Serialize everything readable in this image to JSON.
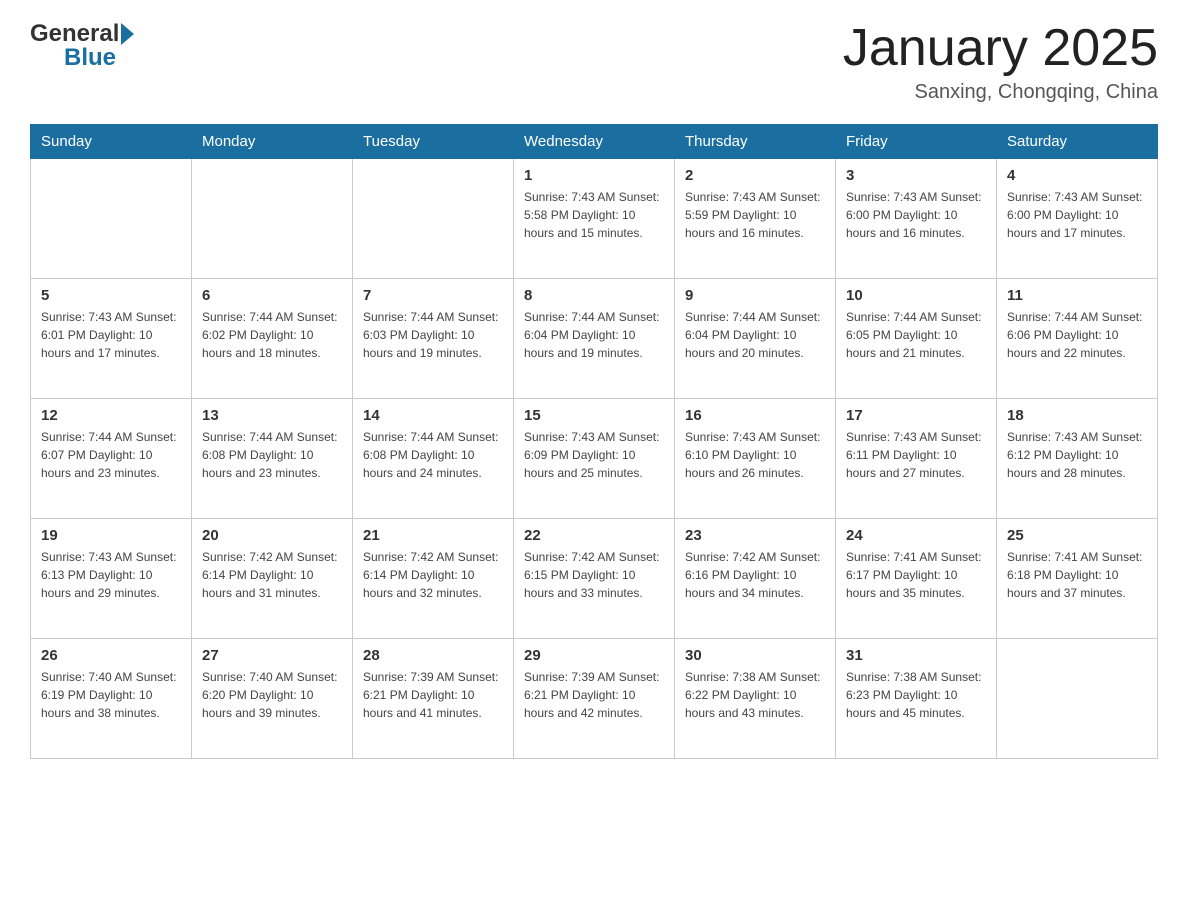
{
  "header": {
    "logo_general": "General",
    "logo_blue": "Blue",
    "title": "January 2025",
    "location": "Sanxing, Chongqing, China"
  },
  "days_of_week": [
    "Sunday",
    "Monday",
    "Tuesday",
    "Wednesday",
    "Thursday",
    "Friday",
    "Saturday"
  ],
  "weeks": [
    [
      {
        "day": "",
        "info": ""
      },
      {
        "day": "",
        "info": ""
      },
      {
        "day": "",
        "info": ""
      },
      {
        "day": "1",
        "info": "Sunrise: 7:43 AM\nSunset: 5:58 PM\nDaylight: 10 hours\nand 15 minutes."
      },
      {
        "day": "2",
        "info": "Sunrise: 7:43 AM\nSunset: 5:59 PM\nDaylight: 10 hours\nand 16 minutes."
      },
      {
        "day": "3",
        "info": "Sunrise: 7:43 AM\nSunset: 6:00 PM\nDaylight: 10 hours\nand 16 minutes."
      },
      {
        "day": "4",
        "info": "Sunrise: 7:43 AM\nSunset: 6:00 PM\nDaylight: 10 hours\nand 17 minutes."
      }
    ],
    [
      {
        "day": "5",
        "info": "Sunrise: 7:43 AM\nSunset: 6:01 PM\nDaylight: 10 hours\nand 17 minutes."
      },
      {
        "day": "6",
        "info": "Sunrise: 7:44 AM\nSunset: 6:02 PM\nDaylight: 10 hours\nand 18 minutes."
      },
      {
        "day": "7",
        "info": "Sunrise: 7:44 AM\nSunset: 6:03 PM\nDaylight: 10 hours\nand 19 minutes."
      },
      {
        "day": "8",
        "info": "Sunrise: 7:44 AM\nSunset: 6:04 PM\nDaylight: 10 hours\nand 19 minutes."
      },
      {
        "day": "9",
        "info": "Sunrise: 7:44 AM\nSunset: 6:04 PM\nDaylight: 10 hours\nand 20 minutes."
      },
      {
        "day": "10",
        "info": "Sunrise: 7:44 AM\nSunset: 6:05 PM\nDaylight: 10 hours\nand 21 minutes."
      },
      {
        "day": "11",
        "info": "Sunrise: 7:44 AM\nSunset: 6:06 PM\nDaylight: 10 hours\nand 22 minutes."
      }
    ],
    [
      {
        "day": "12",
        "info": "Sunrise: 7:44 AM\nSunset: 6:07 PM\nDaylight: 10 hours\nand 23 minutes."
      },
      {
        "day": "13",
        "info": "Sunrise: 7:44 AM\nSunset: 6:08 PM\nDaylight: 10 hours\nand 23 minutes."
      },
      {
        "day": "14",
        "info": "Sunrise: 7:44 AM\nSunset: 6:08 PM\nDaylight: 10 hours\nand 24 minutes."
      },
      {
        "day": "15",
        "info": "Sunrise: 7:43 AM\nSunset: 6:09 PM\nDaylight: 10 hours\nand 25 minutes."
      },
      {
        "day": "16",
        "info": "Sunrise: 7:43 AM\nSunset: 6:10 PM\nDaylight: 10 hours\nand 26 minutes."
      },
      {
        "day": "17",
        "info": "Sunrise: 7:43 AM\nSunset: 6:11 PM\nDaylight: 10 hours\nand 27 minutes."
      },
      {
        "day": "18",
        "info": "Sunrise: 7:43 AM\nSunset: 6:12 PM\nDaylight: 10 hours\nand 28 minutes."
      }
    ],
    [
      {
        "day": "19",
        "info": "Sunrise: 7:43 AM\nSunset: 6:13 PM\nDaylight: 10 hours\nand 29 minutes."
      },
      {
        "day": "20",
        "info": "Sunrise: 7:42 AM\nSunset: 6:14 PM\nDaylight: 10 hours\nand 31 minutes."
      },
      {
        "day": "21",
        "info": "Sunrise: 7:42 AM\nSunset: 6:14 PM\nDaylight: 10 hours\nand 32 minutes."
      },
      {
        "day": "22",
        "info": "Sunrise: 7:42 AM\nSunset: 6:15 PM\nDaylight: 10 hours\nand 33 minutes."
      },
      {
        "day": "23",
        "info": "Sunrise: 7:42 AM\nSunset: 6:16 PM\nDaylight: 10 hours\nand 34 minutes."
      },
      {
        "day": "24",
        "info": "Sunrise: 7:41 AM\nSunset: 6:17 PM\nDaylight: 10 hours\nand 35 minutes."
      },
      {
        "day": "25",
        "info": "Sunrise: 7:41 AM\nSunset: 6:18 PM\nDaylight: 10 hours\nand 37 minutes."
      }
    ],
    [
      {
        "day": "26",
        "info": "Sunrise: 7:40 AM\nSunset: 6:19 PM\nDaylight: 10 hours\nand 38 minutes."
      },
      {
        "day": "27",
        "info": "Sunrise: 7:40 AM\nSunset: 6:20 PM\nDaylight: 10 hours\nand 39 minutes."
      },
      {
        "day": "28",
        "info": "Sunrise: 7:39 AM\nSunset: 6:21 PM\nDaylight: 10 hours\nand 41 minutes."
      },
      {
        "day": "29",
        "info": "Sunrise: 7:39 AM\nSunset: 6:21 PM\nDaylight: 10 hours\nand 42 minutes."
      },
      {
        "day": "30",
        "info": "Sunrise: 7:38 AM\nSunset: 6:22 PM\nDaylight: 10 hours\nand 43 minutes."
      },
      {
        "day": "31",
        "info": "Sunrise: 7:38 AM\nSunset: 6:23 PM\nDaylight: 10 hours\nand 45 minutes."
      },
      {
        "day": "",
        "info": ""
      }
    ]
  ]
}
